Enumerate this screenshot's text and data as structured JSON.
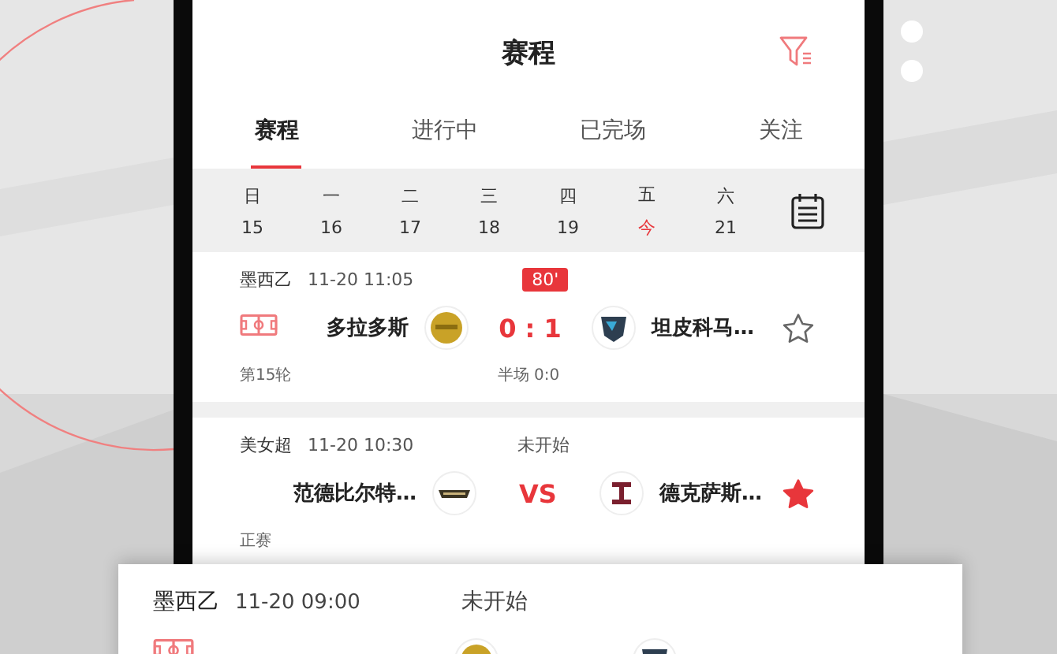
{
  "header": {
    "title": "赛程"
  },
  "tabs": [
    {
      "label": "赛程",
      "selected": true
    },
    {
      "label": "进行中",
      "selected": false
    },
    {
      "label": "已完场",
      "selected": false
    },
    {
      "label": "关注",
      "selected": false
    }
  ],
  "dates": [
    {
      "weekday": "日",
      "day": "15",
      "selected": false
    },
    {
      "weekday": "一",
      "day": "16",
      "selected": false
    },
    {
      "weekday": "二",
      "day": "17",
      "selected": false
    },
    {
      "weekday": "三",
      "day": "18",
      "selected": false
    },
    {
      "weekday": "四",
      "day": "19",
      "selected": false
    },
    {
      "weekday": "五",
      "day": "今",
      "selected": true
    },
    {
      "weekday": "六",
      "day": "21",
      "selected": false
    }
  ],
  "matches": [
    {
      "league": "墨西乙",
      "time": "11-20 11:05",
      "kind": "live",
      "status": "80'",
      "home": "多拉多斯",
      "away": "坦皮科马…",
      "score": "0 : 1",
      "field_icon": true,
      "starred": false,
      "round": "第15轮",
      "halftime": "半场 0:0"
    },
    {
      "league": "美女超",
      "time": "11-20 10:30",
      "kind": "pending",
      "status": "未开始",
      "home": "范德比尔特…",
      "away": "德克萨斯…",
      "score": "VS",
      "field_icon": false,
      "starred": true,
      "round": "正赛"
    }
  ],
  "featured": {
    "league": "墨西乙",
    "time": "11-20 09:00",
    "status": "未开始"
  }
}
